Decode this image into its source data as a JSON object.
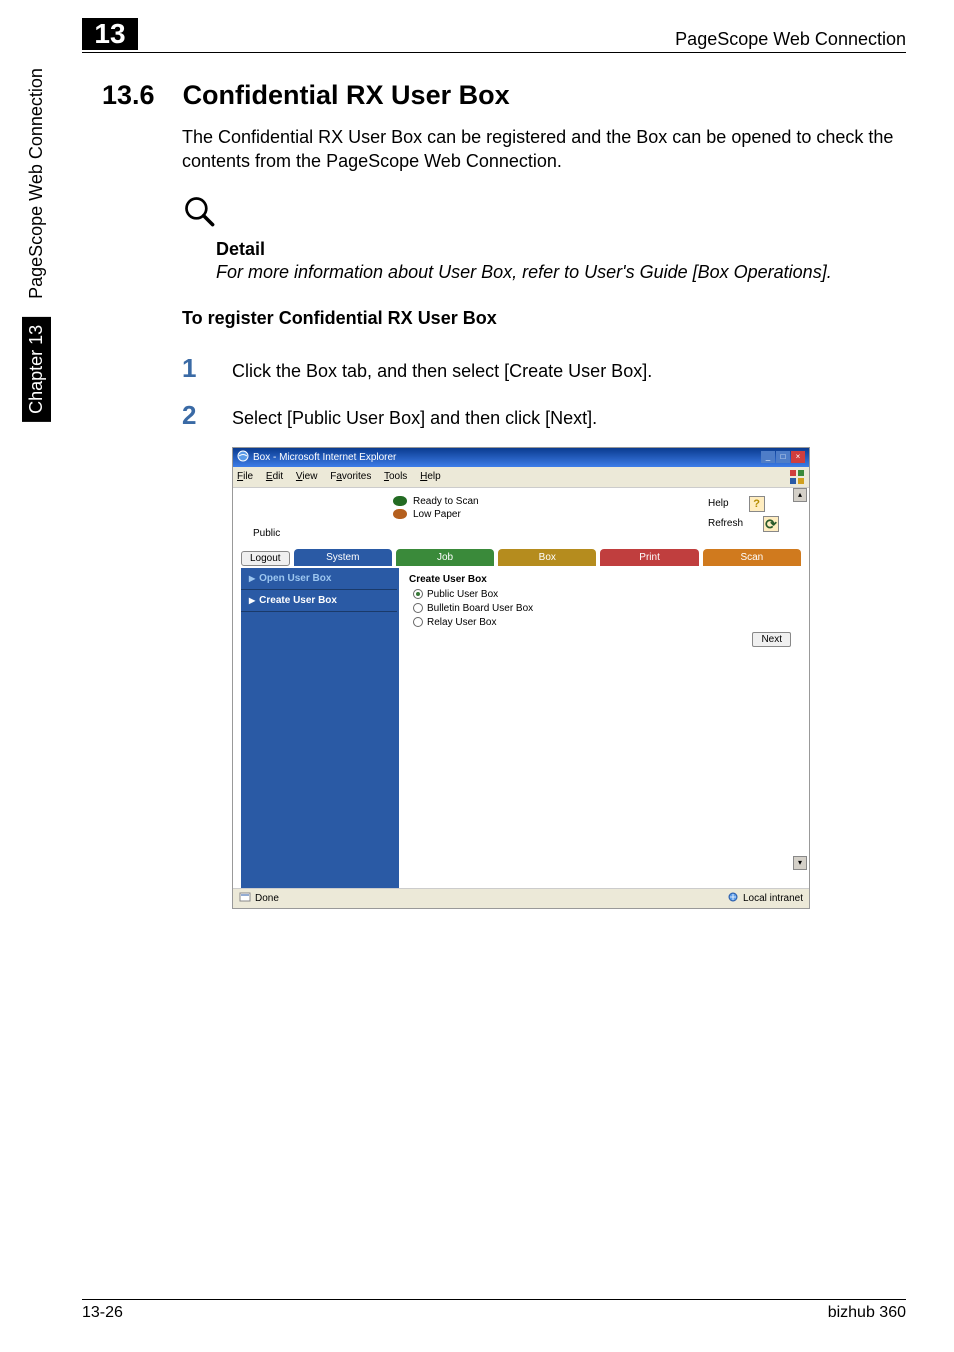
{
  "vertical_label": {
    "chapter": "Chapter 13",
    "section": "PageScope Web Connection"
  },
  "header": {
    "chapter_num": "13",
    "title": "PageScope Web Connection"
  },
  "section": {
    "number": "13.6",
    "title": "Confidential RX User Box"
  },
  "intro": "The Confidential RX User Box can be registered and the Box can be opened to check the contents from the PageScope Web Connection.",
  "detail": {
    "label": "Detail",
    "text": "For more information about User Box, refer to User's Guide [Box Operations]."
  },
  "subheading": "To register Confidential RX User Box",
  "steps": {
    "s1": {
      "num": "1",
      "text": "Click the Box tab, and then select [Create User Box]."
    },
    "s2": {
      "num": "2",
      "text": "Select [Public User Box] and then click [Next]."
    }
  },
  "screenshot": {
    "title": "Box - Microsoft Internet Explorer",
    "menu": {
      "file": "File",
      "edit": "Edit",
      "view": "View",
      "favorites": "Favorites",
      "tools": "Tools",
      "help": "Help"
    },
    "status": {
      "ready": "Ready to Scan",
      "low": "Low Paper"
    },
    "help_label": "Help",
    "refresh_label": "Refresh",
    "public": "Public",
    "logout": "Logout",
    "tabs": {
      "system": "System",
      "job": "Job",
      "box": "Box",
      "print": "Print",
      "scan": "Scan"
    },
    "nav": {
      "open": "Open User Box",
      "create": "Create User Box"
    },
    "panel": {
      "title": "Create User Box",
      "options": {
        "public": "Public User Box",
        "bulletin": "Bulletin Board User Box",
        "relay": "Relay User Box"
      },
      "next": "Next"
    },
    "statusbar": {
      "done": "Done",
      "intranet": "Local intranet"
    }
  },
  "footer": {
    "page": "13-26",
    "product": "bizhub 360"
  }
}
